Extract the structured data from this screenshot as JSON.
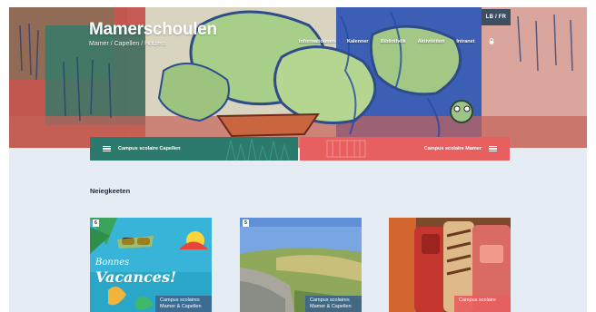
{
  "header": {
    "language_switch": "LB / FR",
    "site_title": "Mamerschoulen",
    "site_subtitle": "Mamer / Capellen / Holzem",
    "nav": [
      {
        "label": "Informatiounen"
      },
      {
        "label": "Kalenner"
      },
      {
        "label": "Bibliothéik"
      },
      {
        "label": "Aktivitéiten"
      },
      {
        "label": "Intranet"
      }
    ],
    "lock_icon": "lock-icon"
  },
  "campus_buttons": {
    "left_label": "Campus scolaire Capellen",
    "right_label": "Campus scolaire Mamer",
    "left_color": "#2c7a6d",
    "right_color": "#e85f5f"
  },
  "news": {
    "heading": "Neiegkeeten",
    "cards": [
      {
        "number": "6",
        "badge": "Campus scolaires Mamer & Capellen",
        "image_text_1": "Bonnes",
        "image_text_2": "Vacances!"
      },
      {
        "number": "5",
        "badge": "Campus scolaires Mamer & Capellen"
      },
      {
        "number": "",
        "badge": "Campus scolaire"
      }
    ]
  }
}
